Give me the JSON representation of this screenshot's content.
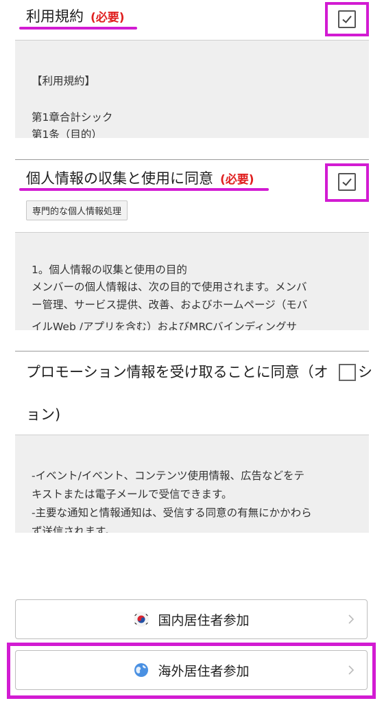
{
  "terms": {
    "title": "利用規約",
    "required": "(必要)",
    "lines": [
      "【利用規約】",
      "",
      "第1章合計シック",
      "第1条（目的）"
    ]
  },
  "privacy": {
    "title": "個人情報の収集と使用に同意",
    "required": "(必要)",
    "detail_button": "専門的な個人情報処理",
    "lines": [
      "1。個人情報の収集と使用の目的",
      "メンバーの個人情報は、次の目的で使用されます。メンバ",
      "ー管理、サービス提供、改善、およびホームページ（モバ",
      "イルWeb /アプリを含む）およびMRCバインディングサ"
    ]
  },
  "promotion": {
    "title_line1": "プロモーション情報を受け取ることに同意（オ",
    "title_line1_tail": "シ",
    "title_line2": "ョン)",
    "lines": [
      "-イベント/イベント、コンテンツ使用情報、広告などをテ",
      "キストまたは電子メールで受信できます。",
      "-主要な通知と情報通知は、受信する同意の有無にかかわら",
      "ず送信されます。"
    ]
  },
  "checkboxes": {
    "terms": "checked",
    "privacy": "checked",
    "promotion": "unchecked"
  },
  "buttons": {
    "domestic": "国内居住者参加",
    "overseas": "海外居住者参加"
  },
  "colors": {
    "highlight": "#d21bd2",
    "required": "#e02020",
    "panel": "#efefef"
  },
  "icons": {
    "domestic": "korea-flag-icon",
    "overseas": "globe-icon",
    "arrow": "chevron-right-icon"
  }
}
